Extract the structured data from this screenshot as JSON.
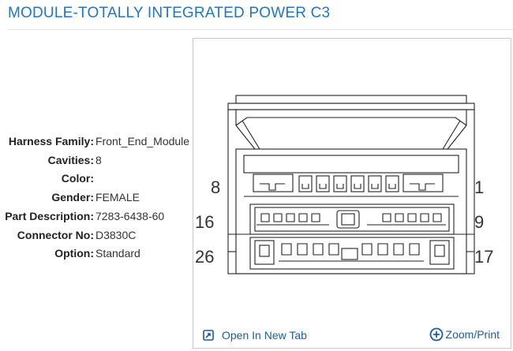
{
  "header": {
    "title": "MODULE-TOTALLY INTEGRATED POWER C3"
  },
  "specs": [
    {
      "label": "Harness Family:",
      "value": "Front_End_Module"
    },
    {
      "label": "Cavities:",
      "value": "8"
    },
    {
      "label": "Color:",
      "value": ""
    },
    {
      "label": "Gender:",
      "value": "FEMALE"
    },
    {
      "label": "Part Description:",
      "value": "7283-6438-60"
    },
    {
      "label": "Connector No:",
      "value": "D3830C"
    },
    {
      "label": "Option:",
      "value": "Standard"
    }
  ],
  "diagram": {
    "pin_labels": {
      "left_top": "8",
      "left_mid": "16",
      "left_bottom": "26",
      "right_top": "1",
      "right_mid": "9",
      "right_bottom": "17"
    }
  },
  "footer": {
    "open_tab_label": "Open In New Tab",
    "zoom_print_label": "Zoom/Print"
  },
  "colors": {
    "title": "#1a77c9",
    "link": "#1a5fa0"
  },
  "icons": {
    "open_tab": "open-new-tab-icon",
    "zoom": "zoom-plus-circle-icon"
  }
}
